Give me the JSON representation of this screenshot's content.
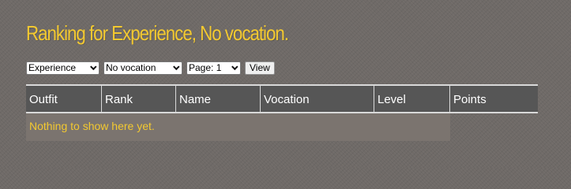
{
  "page": {
    "title": "Ranking for Experience, No vocation."
  },
  "filters": {
    "category": {
      "selected": "Experience"
    },
    "vocation": {
      "selected": "No vocation"
    },
    "page": {
      "selected": "Page: 1"
    },
    "view_button_label": "View"
  },
  "table": {
    "columns": [
      "Outfit",
      "Rank",
      "Name",
      "Vocation",
      "Level",
      "Points"
    ],
    "empty_message": "Nothing to show here yet."
  },
  "colors": {
    "background": "#6f6a67",
    "title": "#f3c930",
    "header_background": "#565656",
    "header_text": "#ffffff",
    "empty_row_background": "#7b746f",
    "empty_row_text": "#f3c930"
  },
  "icons": {
    "dropdown": "chevron-down-icon"
  }
}
